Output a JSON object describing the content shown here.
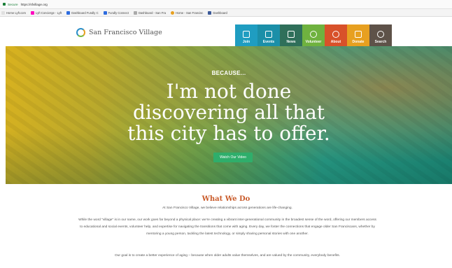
{
  "browser": {
    "secure_label": "Secure",
    "url": "https://sfvillage.org",
    "bookmarks": [
      {
        "label": "Home Lyft.com",
        "color": "#e0e0e0"
      },
      {
        "label": "Lyft Concierge - Lyft",
        "color": "#ff00bf"
      },
      {
        "label": "Dashboard Fundly C",
        "color": "#2d6cdf"
      },
      {
        "label": "Fundly Connect",
        "color": "#2d6cdf"
      },
      {
        "label": "Dashboard - San Fra",
        "color": "#aaaaaa"
      },
      {
        "label": "Home - San Francisc",
        "color": "#e7a020"
      },
      {
        "label": "Dashboard",
        "color": "#3b5998"
      }
    ]
  },
  "site": {
    "logo_text": "San Francisco Village",
    "nav": [
      {
        "label": "Join",
        "color": "#1f9dc1",
        "icon": "id-card-icon"
      },
      {
        "label": "Events",
        "color": "#1b8fa8",
        "icon": "calendar-icon"
      },
      {
        "label": "News",
        "color": "#2f6f5a",
        "icon": "newspaper-icon"
      },
      {
        "label": "Volunteer",
        "color": "#6fb23f",
        "icon": "hand-icon"
      },
      {
        "label": "About",
        "color": "#d8512a",
        "icon": "info-icon"
      },
      {
        "label": "Donate",
        "color": "#e7a020",
        "icon": "gift-icon"
      },
      {
        "label": "Search",
        "color": "#5e5249",
        "icon": "search-icon"
      }
    ]
  },
  "hero": {
    "eyebrow": "BECAUSE...",
    "lines": [
      "I'm not done",
      "discovering all that",
      "this city has to offer."
    ],
    "button": "Watch Our Video"
  },
  "content": {
    "title": "What We Do",
    "intro": "At San Francisco Village, we believe relationships across generations are life-changing.",
    "para1": "While the word \"village\" is in our name, our work goes far beyond a physical place: we're creating a vibrant inter-generational community in the broadest sense of the word, offering our members access to educational and social events, volunteer help, and expertise for navigating the transitions that come with aging. Every day, we foster the connections that engage older San Franciscans, whether by mentoring a young person, tackling the latest technology, or simply sharing personal stories with one another.",
    "para2": "Our goal is to create a better experience of aging – because when older adults value themselves, and are valued by the community, everybody benefits."
  }
}
